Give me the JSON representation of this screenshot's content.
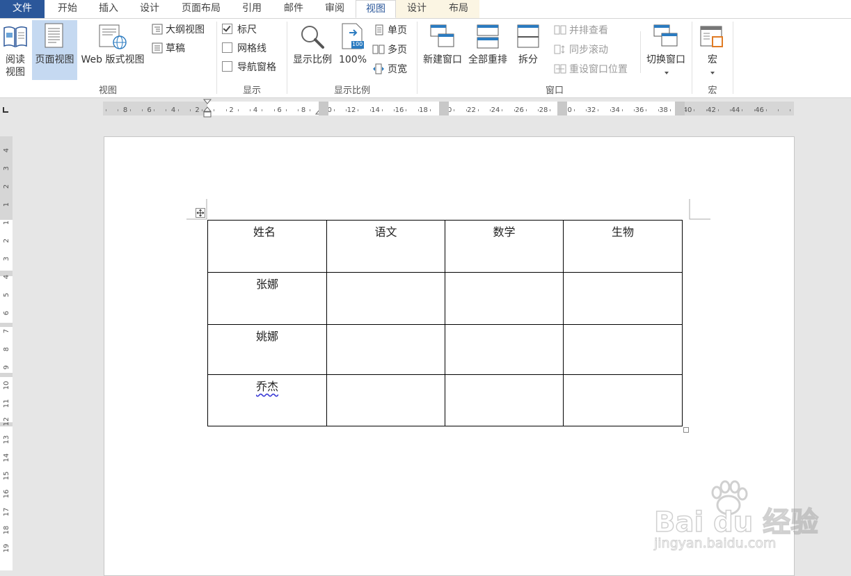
{
  "tabs": [
    {
      "label": "文件",
      "kind": "file"
    },
    {
      "label": "开始"
    },
    {
      "label": "插入"
    },
    {
      "label": "设计"
    },
    {
      "label": "页面布局"
    },
    {
      "label": "引用"
    },
    {
      "label": "邮件"
    },
    {
      "label": "审阅"
    },
    {
      "label": "视图",
      "kind": "active"
    },
    {
      "label": "设计",
      "kind": "context"
    },
    {
      "label": "布局",
      "kind": "context"
    }
  ],
  "ribbon": {
    "views": {
      "group_label": "视图",
      "read_mode_line1": "阅读",
      "read_mode_line2": "视图",
      "print_layout": "页面视图",
      "web_layout": "Web 版式视图",
      "outline": "大纲视图",
      "draft": "草稿"
    },
    "show": {
      "group_label": "显示",
      "ruler": "标尺",
      "ruler_checked": true,
      "gridlines": "网格线",
      "gridlines_checked": false,
      "nav_pane": "导航窗格",
      "nav_pane_checked": false
    },
    "zoom": {
      "group_label": "显示比例",
      "zoom": "显示比例",
      "hundred": "100%",
      "hundred_badge": "100",
      "one_page": "单页",
      "multi_page": "多页",
      "page_width": "页宽"
    },
    "window": {
      "group_label": "窗口",
      "new_window": "新建窗口",
      "arrange_all": "全部重排",
      "split": "拆分",
      "side_by_side": "并排查看",
      "sync_scroll": "同步滚动",
      "reset_position": "重设窗口位置",
      "switch_windows": "切换窗口"
    },
    "macros": {
      "group_label": "宏",
      "macros": "宏"
    }
  },
  "ruler": {
    "left_numbers": [
      "8",
      "6",
      "4",
      "2"
    ],
    "right_numbers": [
      "2",
      "4",
      "6",
      "8",
      "10",
      "12",
      "14",
      "16",
      "18",
      "20",
      "22",
      "24",
      "26",
      "28",
      "30",
      "32",
      "34",
      "36",
      "38",
      "40",
      "42",
      "44",
      "46"
    ],
    "vertical_numbers": [
      "4",
      "3",
      "2",
      "1",
      "1",
      "2",
      "3",
      "4",
      "5",
      "6",
      "7",
      "8",
      "9",
      "10",
      "11",
      "12",
      "13",
      "14",
      "15",
      "16",
      "17",
      "18",
      "19"
    ]
  },
  "table": {
    "header": [
      "姓名",
      "语文",
      "数学",
      "生物"
    ],
    "rows": [
      [
        "张娜",
        "",
        "",
        ""
      ],
      [
        "姚娜",
        "",
        "",
        ""
      ],
      [
        "乔杰",
        "",
        "",
        ""
      ]
    ]
  },
  "watermark": {
    "brand": "Bai du 经验",
    "url": "jingyan.baidu.com"
  }
}
